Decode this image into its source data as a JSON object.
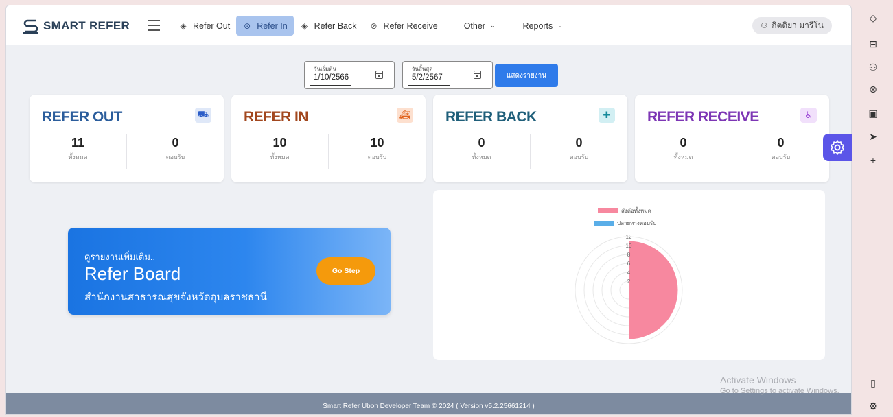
{
  "app": {
    "logo_text": "SMART REFER"
  },
  "nav": {
    "items": [
      {
        "label": "Refer Out",
        "icon": "diamond-arrow-icon",
        "active": false
      },
      {
        "label": "Refer In",
        "icon": "circle-arrow-icon",
        "active": true
      },
      {
        "label": "Refer Back",
        "icon": "diamond-arrow-icon",
        "active": false
      },
      {
        "label": "Refer Receive",
        "icon": "circle-check-icon",
        "active": false
      }
    ],
    "other_label": "Other",
    "reports_label": "Reports"
  },
  "user": {
    "name": "กิตติยา มารีโน"
  },
  "filters": {
    "start": {
      "label": "วันเริ่มต้น",
      "value": "1/10/2566"
    },
    "end": {
      "label": "วันสิ้นสุด",
      "value": "5/2/2567"
    },
    "show_button": "แสดงรายงาน"
  },
  "cards": [
    {
      "title": "REFER OUT",
      "color": "#2b5d9c",
      "icon": "truck-icon",
      "icon_bg": "#dfe8f8",
      "total": "11",
      "total_label": "ทั้งหมด",
      "accepted": "0",
      "accepted_label": "ตอบรับ"
    },
    {
      "title": "REFER IN",
      "color": "#a2471e",
      "icon": "ambulance-icon",
      "icon_bg": "#fde0cf",
      "total": "10",
      "total_label": "ทั้งหมด",
      "accepted": "10",
      "accepted_label": "ตอบรับ"
    },
    {
      "title": "REFER BACK",
      "color": "#1f5f7a",
      "icon": "medical-truck-icon",
      "icon_bg": "#d2eff3",
      "total": "0",
      "total_label": "ทั้งหมด",
      "accepted": "0",
      "accepted_label": "ตอบรับ"
    },
    {
      "title": "REFER RECEIVE",
      "color": "#7d36b5",
      "icon": "wheelchair-icon",
      "icon_bg": "#f1e0fb",
      "total": "0",
      "total_label": "ทั้งหมด",
      "accepted": "0",
      "accepted_label": "ตอบรับ"
    }
  ],
  "banner": {
    "line1": "ดูรายงานเพิ่มเติม..",
    "line2": "Refer Board",
    "line3": "สำนักงานสาธารณสุขจังหวัดอุบลราชธานี",
    "button": "Go Step"
  },
  "chart_data": {
    "type": "polar-area",
    "series": [
      {
        "name": "ส่งต่อทั้งหมด",
        "color": "#f7889f",
        "value": 11
      },
      {
        "name": "ปลายทางตอบรับ",
        "color": "#5aaee8",
        "value": 0
      }
    ],
    "ticks": [
      "12",
      "10",
      "8",
      "6",
      "4",
      "2"
    ],
    "r_max": 12
  },
  "footer": {
    "text": "Smart Refer Ubon Developer Team © 2024 ( Version v5.2.25661214 )"
  },
  "watermark": {
    "line1": "Activate Windows",
    "line2": "Go to Settings to activate Windows."
  }
}
